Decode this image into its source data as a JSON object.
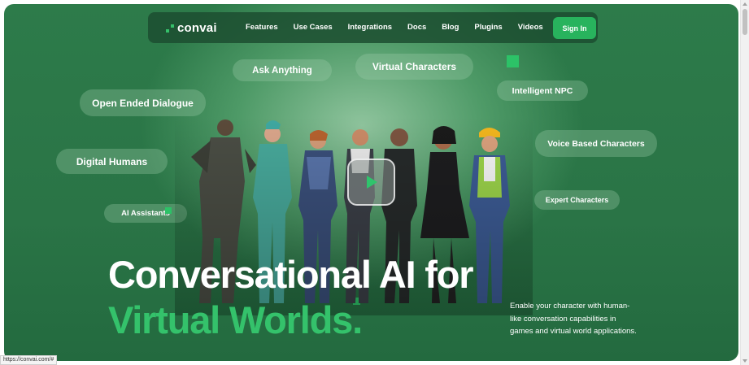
{
  "brand": {
    "name": "convai",
    "accent": "#28b35d"
  },
  "nav": {
    "links": [
      "Features",
      "Use Cases",
      "Integrations",
      "Docs",
      "Blog",
      "Plugins",
      "Videos"
    ],
    "signin_label": "Sign In"
  },
  "tags": {
    "ask_anything": "Ask Anything",
    "virtual_characters": "Virtual Characters",
    "intelligent_npc": "Intelligent NPC",
    "open_ended_dialogue": "Open Ended Dialogue",
    "digital_humans": "Digital Humans",
    "voice_based_characters": "Voice Based Characters",
    "ai_assistants": "AI Assistants",
    "expert_characters": "Expert Characters"
  },
  "hero": {
    "headline_line1": "Conversational AI for",
    "headline_line2": "Virtual Worlds.",
    "description": "Enable your character with human-like conversation capabilities in games and virtual world applications.",
    "play_icon": "play-icon"
  },
  "status_bar": {
    "url": "https://convai.com/#"
  }
}
